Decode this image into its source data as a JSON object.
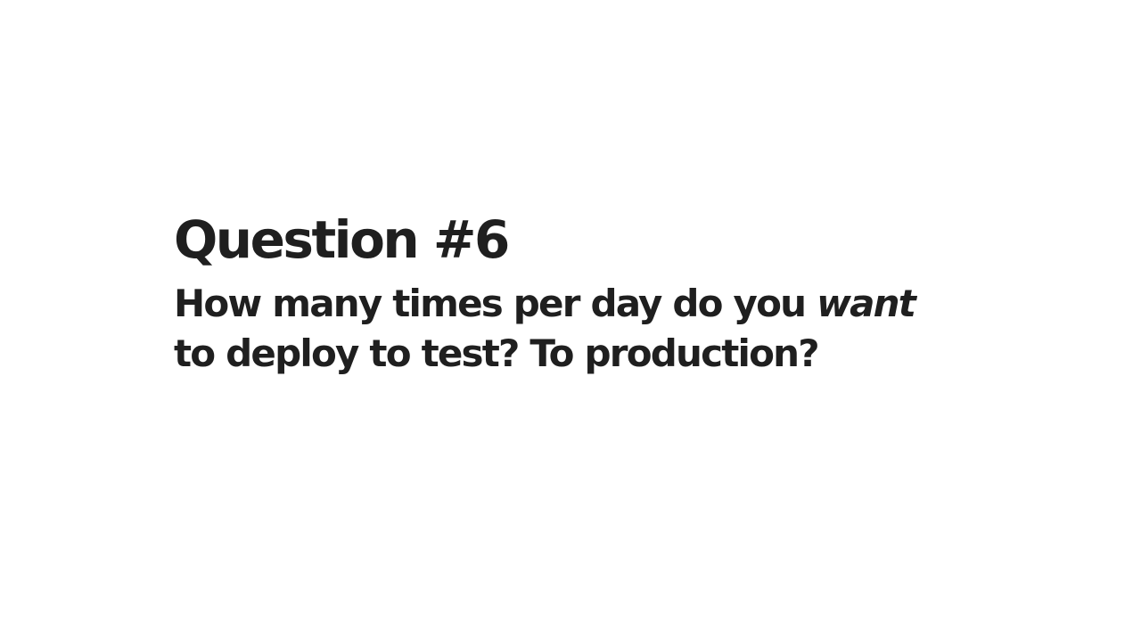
{
  "slide": {
    "title": "Question #6",
    "question": {
      "line1_before": "How many times per day do you ",
      "line1_emphasis": "want",
      "line2": "to deploy to test? To production?"
    }
  },
  "colors": {
    "background": "#ffffff",
    "text": "#1f1f1f"
  }
}
